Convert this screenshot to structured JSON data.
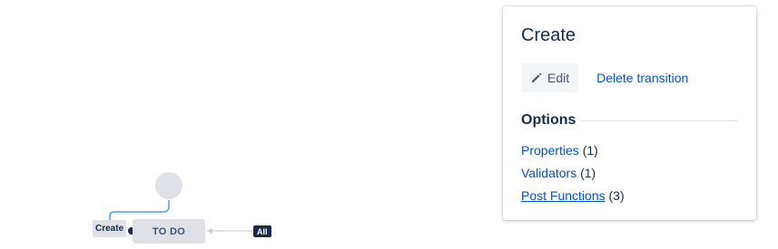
{
  "diagram": {
    "transition_label": "Create",
    "status_label": "TO DO",
    "all_badge": "All"
  },
  "panel": {
    "title": "Create",
    "edit_label": "Edit",
    "delete_label": "Delete transition",
    "options_title": "Options",
    "options": [
      {
        "label": "Properties",
        "count": "(1)"
      },
      {
        "label": "Validators",
        "count": "(1)"
      },
      {
        "label": "Post Functions",
        "count": "(3)"
      }
    ]
  },
  "colors": {
    "link": "#0052cc",
    "text": "#172b4d",
    "node_bg": "#dfe1e6",
    "transition_line": "#4c9aff"
  },
  "icons": {
    "edit": "pencil-icon"
  }
}
